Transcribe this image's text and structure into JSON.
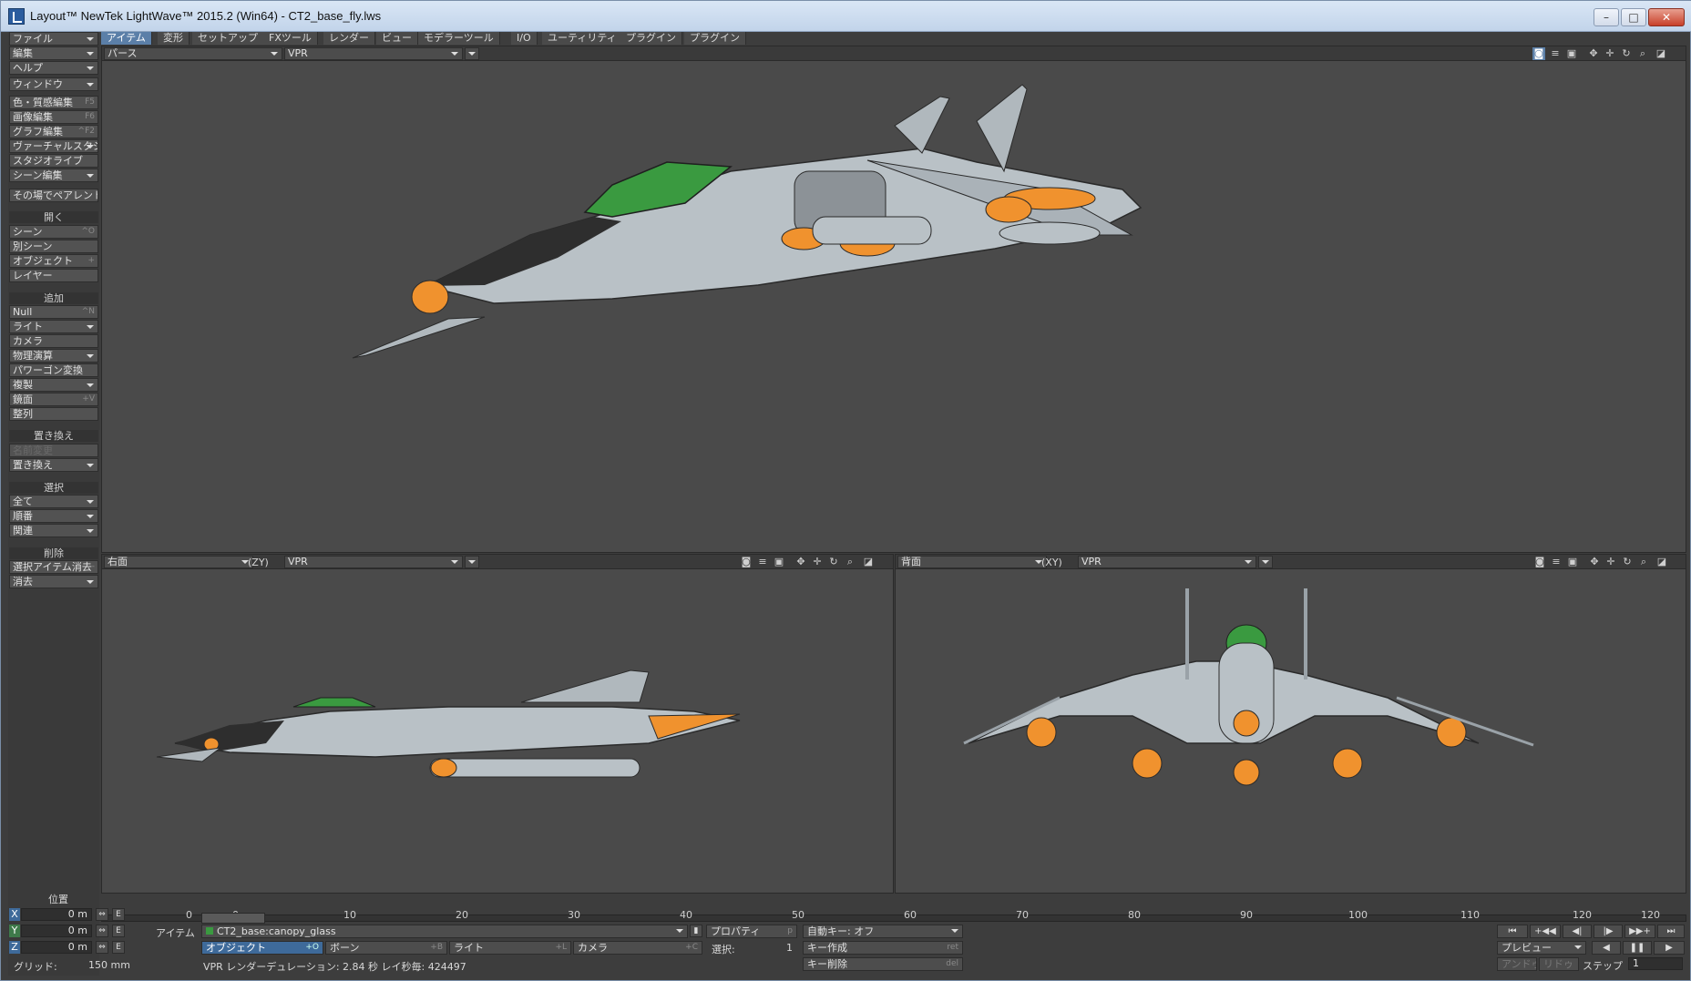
{
  "window": {
    "title": "Layout™ NewTek LightWave™ 2015.2 (Win64) - CT2_base_fly.lws",
    "minimize": "–",
    "maximize": "□",
    "close": "✕"
  },
  "tabs": [
    "アイテム",
    "変形",
    "セットアップ",
    "FXツール",
    "レンダー",
    "ビュー",
    "モデラーツール",
    "I/O",
    "ユーティリティ",
    "プラグイン",
    "プラグイン"
  ],
  "left": {
    "menus": [
      {
        "label": "ファイル",
        "sc": ""
      },
      {
        "label": "編集",
        "sc": ""
      },
      {
        "label": "ヘルプ",
        "sc": ""
      },
      {
        "label": "ウィンドウ",
        "sc": ""
      },
      {
        "label": "色・質感編集",
        "sc": "F5"
      },
      {
        "label": "画像編集",
        "sc": "F6"
      },
      {
        "label": "グラフ編集",
        "sc": "^F2"
      },
      {
        "label": "ヴァーチャルスタジオ",
        "sc": ""
      },
      {
        "label": "スタジオライブ",
        "sc": ""
      },
      {
        "label": "シーン編集",
        "sc": ""
      },
      {
        "label": "その場でペアレント",
        "sc": ""
      }
    ],
    "open_head": "開く",
    "open": [
      {
        "label": "シーン",
        "sc": "^O"
      },
      {
        "label": "別シーン",
        "sc": ""
      },
      {
        "label": "オブジェクト",
        "sc": "+"
      },
      {
        "label": "レイヤー",
        "sc": ""
      }
    ],
    "add_head": "追加",
    "add": [
      {
        "label": "Null",
        "sc": "^N"
      },
      {
        "label": "ライト",
        "sc": ""
      },
      {
        "label": "カメラ",
        "sc": ""
      },
      {
        "label": "物理演算",
        "sc": ""
      },
      {
        "label": "パワーゴン変換",
        "sc": ""
      },
      {
        "label": "複製",
        "sc": ""
      },
      {
        "label": "鏡面",
        "sc": "+V"
      },
      {
        "label": "整列",
        "sc": ""
      }
    ],
    "replace_head": "置き換え",
    "replace": [
      {
        "label": "名前変更",
        "sc": ""
      },
      {
        "label": "置き換え",
        "sc": ""
      }
    ],
    "select_head": "選択",
    "select": [
      {
        "label": "全て",
        "sc": ""
      },
      {
        "label": "順番",
        "sc": ""
      },
      {
        "label": "関連",
        "sc": ""
      }
    ],
    "delete_head": "削除",
    "delete": [
      {
        "label": "選択アイテム消去",
        "sc": "-"
      },
      {
        "label": "消去",
        "sc": ""
      }
    ],
    "position_label": "位置"
  },
  "viewports": {
    "top": {
      "view": "パース",
      "mode": "VPR"
    },
    "bl": {
      "view": "右面",
      "axis": "(ZY)",
      "mode": "VPR"
    },
    "br": {
      "view": "背面",
      "axis": "(XY)",
      "mode": "VPR"
    }
  },
  "colors": {
    "body": "#b9c1c6",
    "orange": "#f0922e",
    "green": "#3a9a40",
    "dark": "#2a2a2a"
  },
  "timeline": {
    "start": "0",
    "ticks": [
      "0",
      "10",
      "20",
      "30",
      "40",
      "50",
      "60",
      "70",
      "80",
      "90",
      "100",
      "110",
      "120"
    ],
    "end": "120"
  },
  "bottom": {
    "x": "X",
    "y": "Y",
    "z": "Z",
    "x_val": "0 m",
    "y_val": "0 m",
    "z_val": "0 m",
    "e": "E",
    "grid_label": "グリッド:",
    "grid_val": "150 mm",
    "item_label": "アイテム",
    "current_item": "CT2_base:canopy_glass",
    "properties": "プロパティ",
    "properties_sc": "p",
    "objects": "オブジェクト",
    "objects_sc": "+O",
    "bones": "ボーン",
    "bones_sc": "+B",
    "lights": "ライト",
    "lights_sc": "+L",
    "cameras": "カメラ",
    "cameras_sc": "+C",
    "selected_label": "選択:",
    "selected_val": "1",
    "vpr_status": "VPR レンダーデュレーション: 2.84 秒  レイ秒毎: 424497",
    "autokey": "自動キー: オフ",
    "create_key": "キー作成",
    "create_key_sc": "ret",
    "delete_key": "キー削除",
    "delete_key_sc": "del",
    "preview": "プレビュー",
    "step_label": "ステップ",
    "step_val": "1",
    "undo": "アンドゥ",
    "redo": "リドゥ"
  }
}
